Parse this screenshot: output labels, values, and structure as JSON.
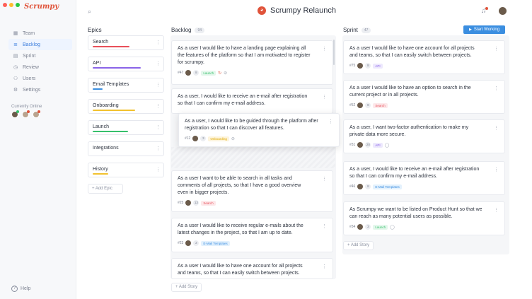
{
  "app": {
    "logo_text": "Scrumpy",
    "project_title": "Scrumpy Relaunch",
    "project_logo_glyph": "◕",
    "colors": {
      "accent": "#3b8ee0",
      "brand": "#e0533a"
    }
  },
  "sidebar": {
    "items": [
      {
        "label": "Team",
        "icon": "grid-icon",
        "glyph": "▦"
      },
      {
        "label": "Backlog",
        "icon": "list-icon",
        "glyph": "≡"
      },
      {
        "label": "Sprint",
        "icon": "board-icon",
        "glyph": "▤"
      },
      {
        "label": "Review",
        "icon": "clock-icon",
        "glyph": "◷"
      },
      {
        "label": "Users",
        "icon": "users-icon",
        "glyph": "⚇"
      },
      {
        "label": "Settings",
        "icon": "gear-icon",
        "glyph": "⚙"
      }
    ],
    "online_label": "Currently Online",
    "help_label": "Help",
    "help_glyph": "?"
  },
  "header": {
    "search_glyph": "⌕",
    "bell_glyph": "♫"
  },
  "epics": {
    "title": "Epics",
    "items": [
      {
        "label": "Search",
        "color": "#e8505b",
        "progress": 0.85
      },
      {
        "label": "API",
        "color": "#8a63e8",
        "progress": 0.8
      },
      {
        "label": "Email Templates",
        "color": "#3b8ee0",
        "progress": 0.2
      },
      {
        "label": "Onboarding",
        "color": "#f2c12e",
        "progress": 0.7
      },
      {
        "label": "Launch",
        "color": "#37c06b",
        "progress": 0.6
      },
      {
        "label": "Integrations",
        "color": "#cccccc",
        "progress": 0
      },
      {
        "label": "History",
        "color": "#f2c12e",
        "progress": 0.3
      }
    ],
    "add_label": "+ Add Epic"
  },
  "backlog": {
    "title": "Backlog",
    "count": "94",
    "add_label": "+ Add Story",
    "cards": [
      {
        "text": "As a user I would like to have a landing page explaining all the features of the platform so that I am motivated to register for scrumpy.",
        "id": "#47",
        "points": "8",
        "tag": "Launch",
        "tag_class": "launch",
        "icons": [
          "↻",
          "⊘"
        ]
      },
      {
        "text": "As a user, I would like to receive an e-mail after registration so that I can confirm my e-mail address.",
        "id": "",
        "points": "",
        "tag": "",
        "icons": []
      },
      {
        "text": "As a user I want to be able to search in all tasks and comments of all projects, so that I have a good overview even in bigger projects.",
        "id": "#25",
        "points": "13",
        "tag": "Search",
        "tag_class": "search",
        "icons": []
      },
      {
        "text": "As a user I would like to receive regular e-mails about the latest changes in the project, so that I am up to date.",
        "id": "#23",
        "points": "2",
        "tag": "E-Mail Templates",
        "tag_class": "email",
        "icons": []
      },
      {
        "text": "As a user I would like to have one account for all projects and teams, so that I can easily switch between projects.",
        "id": "",
        "points": "",
        "tag": "",
        "icons": []
      }
    ],
    "floating": {
      "text": "As a user, I would like to be guided through the platform after registration so that I can discover all features.",
      "id": "#12",
      "points": "3",
      "tag": "Onboarding",
      "tag_class": "onboarding",
      "icons": [
        "⊘"
      ]
    }
  },
  "sprint": {
    "title": "Sprint",
    "count": "47",
    "start_label": "Start Working",
    "start_glyph": "▶",
    "add_label": "+ Add Story",
    "cards": [
      {
        "text": "As a user I would like to have one account for all projects and teams, so that I can easily switch between projects.",
        "id": "#75",
        "points": "8",
        "tag": "API",
        "tag_class": "api",
        "icons": []
      },
      {
        "text": "As a user I would like to have an option to search in the current project or in all projects.",
        "id": "#52",
        "points": "8",
        "tag": "Search",
        "tag_class": "search",
        "icons": []
      },
      {
        "text": "As a user, I want two-factor authentication to make my private data more secure.",
        "id": "#31",
        "points": "20",
        "tag": "API",
        "tag_class": "api",
        "icons": [
          "◯"
        ]
      },
      {
        "text": "As a user, I would like to receive an e-mail after registration so that I can confirm my e-mail address.",
        "id": "#46",
        "points": "8",
        "tag": "E-Mail Templates",
        "tag_class": "email",
        "icons": []
      },
      {
        "text": "As Scrumpy we want to be listed on Product Hunt so that we can reach as many potential users as possible.",
        "id": "#34",
        "points": "3",
        "tag": "Launch",
        "tag_class": "launch",
        "icons": [
          "◯"
        ]
      }
    ]
  }
}
